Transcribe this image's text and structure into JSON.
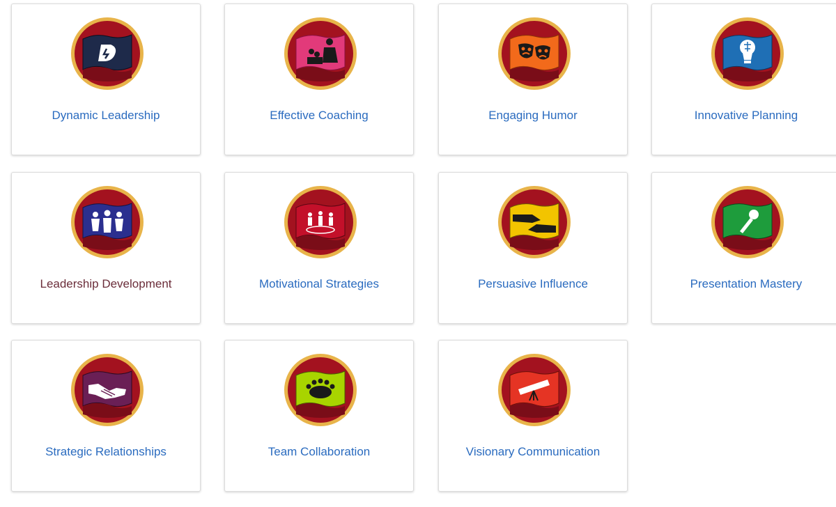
{
  "cards": [
    {
      "label": "Dynamic Leadership",
      "icon": "dynamic-leadership-icon",
      "flag": "#1e2a4a",
      "visited": false
    },
    {
      "label": "Effective Coaching",
      "icon": "effective-coaching-icon",
      "flag": "#e23a7a",
      "visited": false
    },
    {
      "label": "Engaging Humor",
      "icon": "engaging-humor-icon",
      "flag": "#f26a1b",
      "visited": false
    },
    {
      "label": "Innovative Planning",
      "icon": "innovative-planning-icon",
      "flag": "#1f6fb5",
      "visited": false
    },
    {
      "label": "Leadership Development",
      "icon": "leadership-development-icon",
      "flag": "#2b2f8f",
      "visited": true
    },
    {
      "label": "Motivational Strategies",
      "icon": "motivational-strategies-icon",
      "flag": "#c3102a",
      "visited": false
    },
    {
      "label": "Persuasive Influence",
      "icon": "persuasive-influence-icon",
      "flag": "#f2c400",
      "visited": false
    },
    {
      "label": "Presentation Mastery",
      "icon": "presentation-mastery-icon",
      "flag": "#1e9c3c",
      "visited": false
    },
    {
      "label": "Strategic Relationships",
      "icon": "strategic-relationships-icon",
      "flag": "#6a1f55",
      "visited": false
    },
    {
      "label": "Team Collaboration",
      "icon": "team-collaboration-icon",
      "flag": "#a8d400",
      "visited": false
    },
    {
      "label": "Visionary Communication",
      "icon": "visionary-communication-icon",
      "flag": "#e53424",
      "visited": false
    }
  ],
  "colors": {
    "link": "#2a6bbf",
    "visited": "#6b2d3a",
    "badge_red": "#a3121f",
    "badge_gold": "#e8b44a"
  }
}
